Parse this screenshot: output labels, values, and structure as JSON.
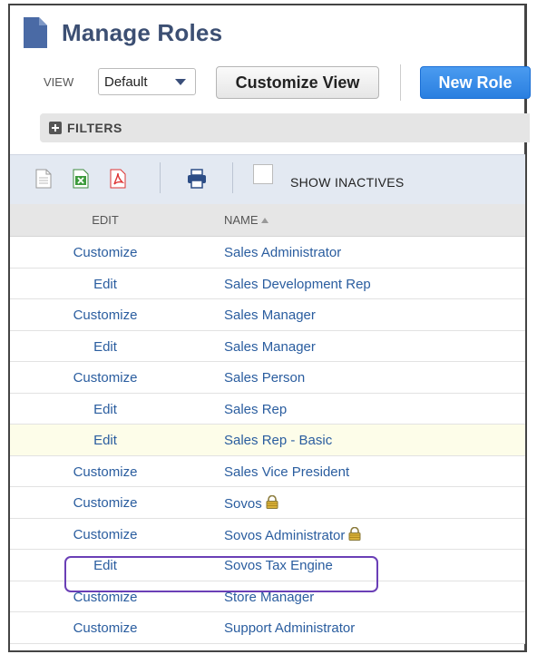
{
  "header": {
    "title": "Manage Roles"
  },
  "view": {
    "label": "VIEW",
    "selected": "Default",
    "customize_label": "Customize View",
    "new_role_label": "New Role"
  },
  "filters": {
    "label": "FILTERS"
  },
  "toolbar": {
    "show_inactives_label": "SHOW INACTIVES"
  },
  "table": {
    "columns": [
      "EDIT",
      "NAME"
    ],
    "rows": [
      {
        "action": "Customize",
        "name": "Sales Administrator",
        "locked": false
      },
      {
        "action": "Edit",
        "name": "Sales Development Rep",
        "locked": false
      },
      {
        "action": "Customize",
        "name": "Sales Manager",
        "locked": false
      },
      {
        "action": "Edit",
        "name": "Sales Manager",
        "locked": false
      },
      {
        "action": "Customize",
        "name": "Sales Person",
        "locked": false
      },
      {
        "action": "Edit",
        "name": "Sales Rep",
        "locked": false
      },
      {
        "action": "Edit",
        "name": "Sales Rep - Basic",
        "locked": false
      },
      {
        "action": "Customize",
        "name": "Sales Vice President",
        "locked": false
      },
      {
        "action": "Customize",
        "name": "Sovos",
        "locked": true
      },
      {
        "action": "Customize",
        "name": "Sovos Administrator",
        "locked": true
      },
      {
        "action": "Edit",
        "name": "Sovos Tax Engine",
        "locked": false
      },
      {
        "action": "Customize",
        "name": "Store Manager",
        "locked": false
      },
      {
        "action": "Customize",
        "name": "Support Administrator",
        "locked": false
      }
    ]
  },
  "colors": {
    "accent": "#2a7fe0",
    "link": "#2a5d9f",
    "title": "#3c4f73",
    "highlight": "#6a3fb6"
  }
}
